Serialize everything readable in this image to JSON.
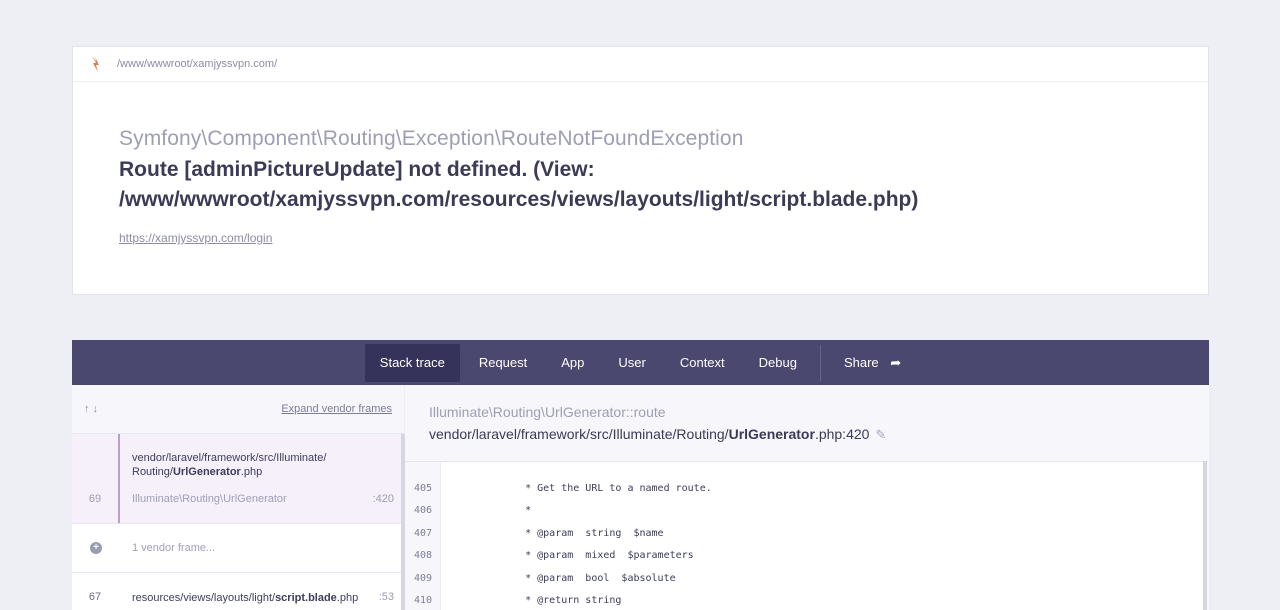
{
  "header": {
    "path": "/www/wwwroot/xamjyssvpn.com/",
    "exception_class": "Symfony\\Component\\Routing\\Exception\\RouteNotFoundException",
    "message": "Route [adminPictureUpdate] not defined. (View: /www/wwwroot/xamjyssvpn.com/resources/views/layouts/light/script.blade.php)",
    "url": "https://xamjyssvpn.com/login"
  },
  "tabs": [
    {
      "label": "Stack trace",
      "active": true
    },
    {
      "label": "Request"
    },
    {
      "label": "App"
    },
    {
      "label": "User"
    },
    {
      "label": "Context"
    },
    {
      "label": "Debug"
    },
    {
      "label": "Share",
      "icon": "share-icon"
    }
  ],
  "stack": {
    "arrows": "↑↓",
    "expand_label": "Expand vendor frames",
    "frames": [
      {
        "number": "69",
        "file_prefix": "vendor/laravel/framework/src/Illuminate/",
        "file_dir": "Routing/",
        "file_name": "UrlGenerator",
        "file_ext": ".php",
        "class": "Illuminate\\Routing\\UrlGenerator",
        "line": ":420"
      },
      {
        "collapsed_label": "1 vendor frame..."
      },
      {
        "number": "67",
        "file_prefix": "resources/views/layouts/light/",
        "file_name": "script.blade",
        "file_ext": ".php",
        "line": ":53"
      }
    ]
  },
  "detail": {
    "class_method": "Illuminate\\Routing\\UrlGenerator::route",
    "file_prefix": "vendor/laravel/framework/src/Illuminate/Routing/",
    "file_name": "UrlGenerator",
    "file_suffix": ".php:420",
    "code_lines": [
      {
        "n": "405",
        "text": "     * Get the URL to a named route."
      },
      {
        "n": "406",
        "text": "     *"
      },
      {
        "n": "407",
        "text": "     * @param  string  $name"
      },
      {
        "n": "408",
        "text": "     * @param  mixed  $parameters"
      },
      {
        "n": "409",
        "text": "     * @param  bool  $absolute"
      },
      {
        "n": "410",
        "text": "     * @return string"
      }
    ]
  },
  "colors": {
    "tab_bar": "#4b4870",
    "tab_active": "#35335a",
    "frame_highlight": "#f5f0fa"
  }
}
